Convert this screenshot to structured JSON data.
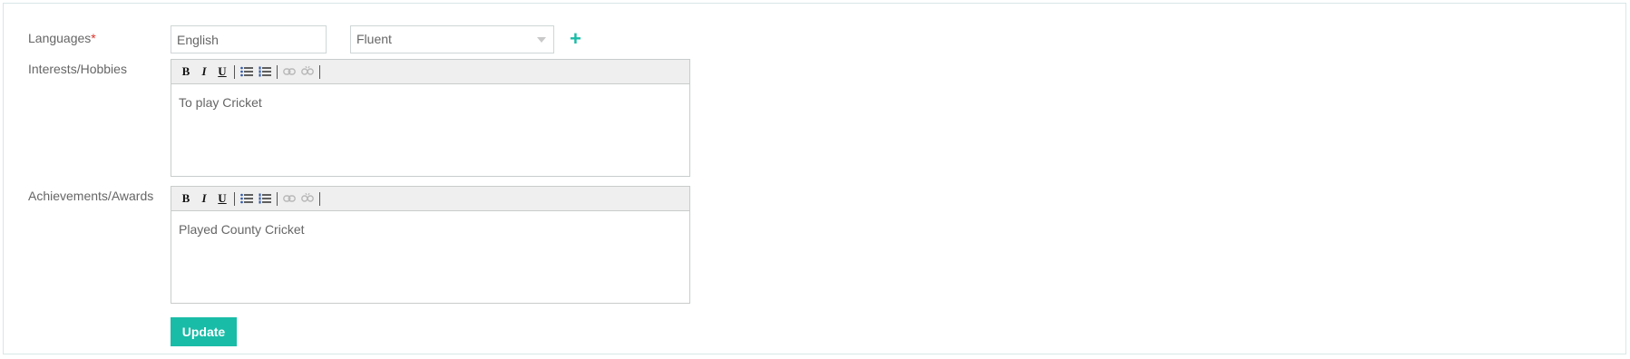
{
  "form": {
    "languages": {
      "label": "Languages",
      "required_mark": "*",
      "language_value": "English",
      "proficiency_value": "Fluent",
      "add_symbol": "+"
    },
    "interests": {
      "label": "Interests/Hobbies",
      "content": "To play Cricket"
    },
    "achievements": {
      "label": "Achievements/Awards",
      "content": "Played County Cricket"
    },
    "toolbar": {
      "bold": "B",
      "italic": "I",
      "underline": "U",
      "icons": [
        "bullet-list-icon",
        "numbered-list-icon",
        "link-icon",
        "unlink-icon"
      ]
    },
    "submit_label": "Update"
  },
  "colors": {
    "accent": "#19bca7",
    "required": "#d9342b",
    "border": "#cfd6d6",
    "toolbar_bg": "#efefef"
  }
}
